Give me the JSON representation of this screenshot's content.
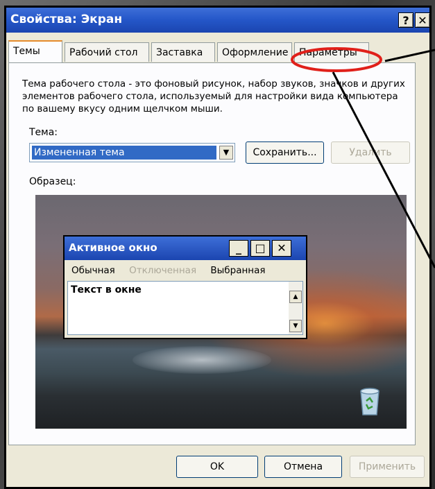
{
  "window": {
    "title": "Свойства: Экран",
    "help_glyph": "?",
    "close_glyph": "✕"
  },
  "tabs": [
    {
      "label": "Темы",
      "active": true
    },
    {
      "label": "Рабочий стол",
      "active": false
    },
    {
      "label": "Заставка",
      "active": false
    },
    {
      "label": "Оформление",
      "active": false
    },
    {
      "label": "Параметры",
      "active": false,
      "highlighted": true
    }
  ],
  "themes_tab": {
    "description": "Тема рабочего стола - это фоновый рисунок, набор звуков, значков и других элементов рабочего стола, используемый для настройки вида компьютера по вашему вкусу одним щелчком мыши.",
    "theme_label": "Тема:",
    "theme_value": "Измененная тема",
    "save_button": "Сохранить...",
    "delete_button": "Удалить",
    "sample_label": "Образец:"
  },
  "preview_window": {
    "title": "Активное окно",
    "menu": {
      "normal": "Обычная",
      "disabled": "Отключенная",
      "selected": "Выбранная"
    },
    "text": "Текст в окне"
  },
  "footer": {
    "ok": "OK",
    "cancel": "Отмена",
    "apply": "Применить"
  },
  "colors": {
    "titlebar": "#2456c8",
    "highlight_ellipse": "#e0201a",
    "selection": "#316ac5"
  }
}
